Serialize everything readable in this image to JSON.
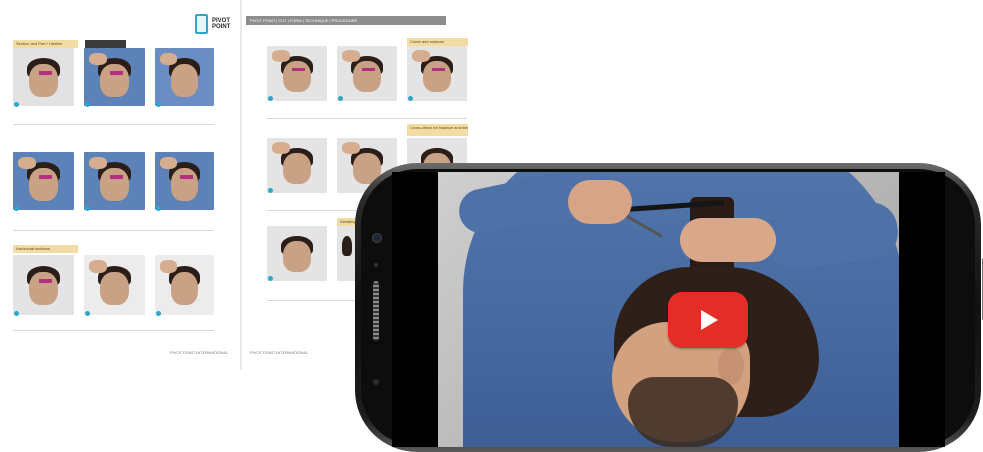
{
  "book": {
    "logo_text": "PIVOT POINT",
    "breadcrumb": "PIVOT POINT | CUT | FORM | TECHNIQUE | PROCEDURE",
    "left_page": {
      "step_labels": [
        "Section and Part / Hairline",
        "Horizontal sections"
      ],
      "footer": "PIVOT POINT INTERNATIONAL"
    },
    "right_page": {
      "step_labels": [
        "Comb and scissors",
        "Cross-check for balance and blending",
        "Detailing"
      ],
      "footer": "PIVOT POINT INTERNATIONAL"
    }
  },
  "video": {
    "play_button": "play-icon",
    "accent_color": "#e52d27"
  }
}
